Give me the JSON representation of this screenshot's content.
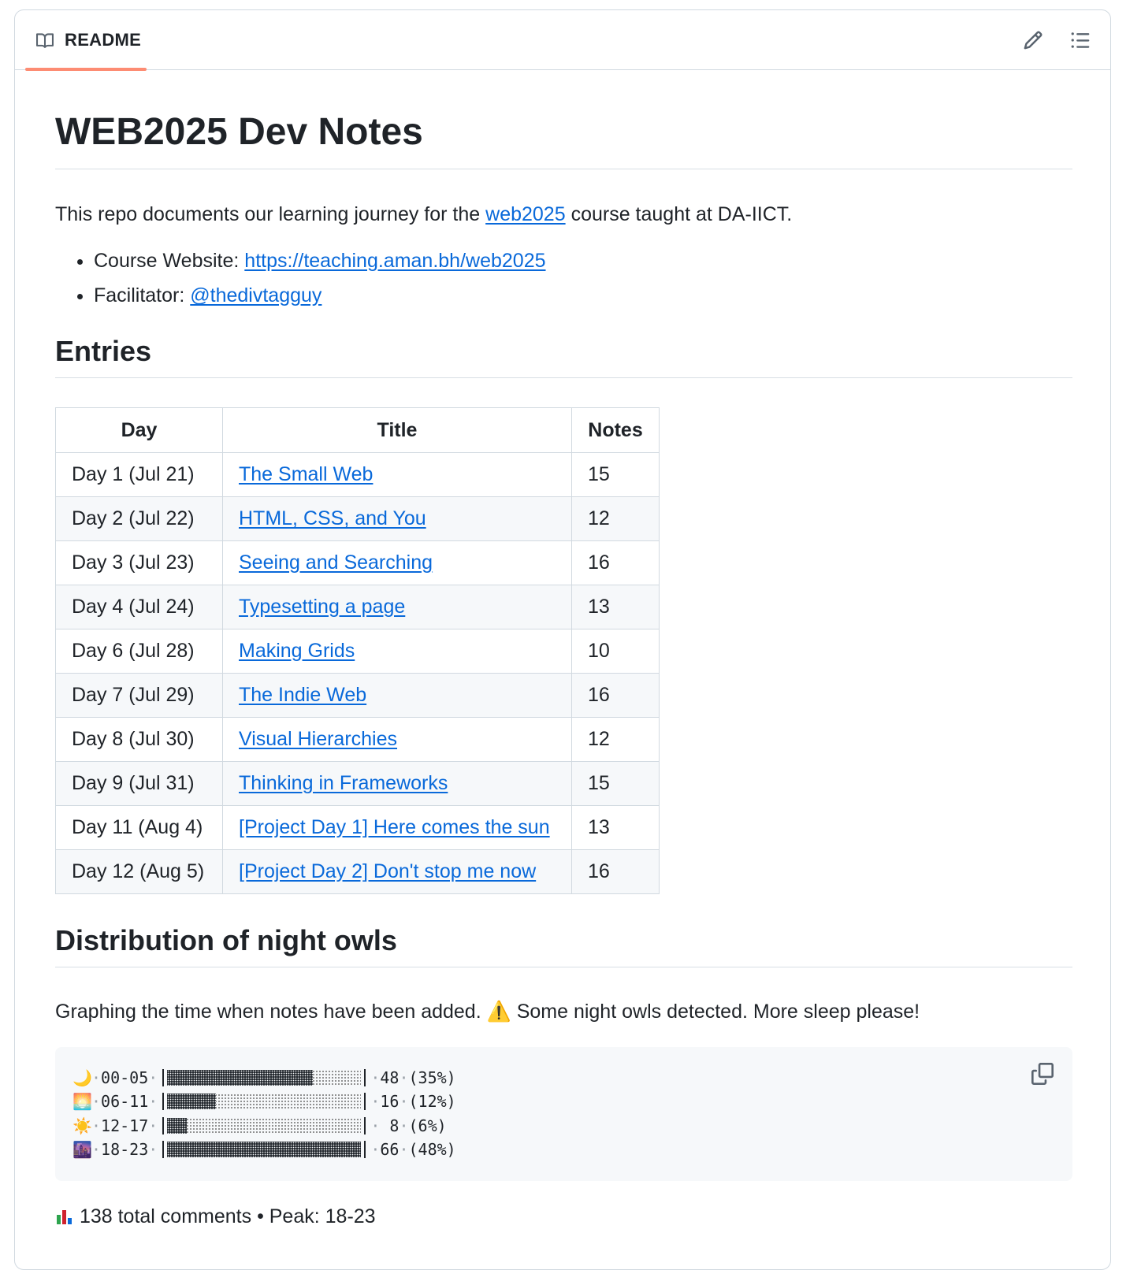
{
  "header": {
    "tab_label": "README",
    "icons": [
      "book-icon",
      "pencil-icon",
      "list-icon"
    ]
  },
  "doc": {
    "title": "WEB2025 Dev Notes",
    "intro_before": "This repo documents our learning journey for the ",
    "intro_link": "web2025",
    "intro_after": " course taught at DA-IICT.",
    "website_label": "Course Website: ",
    "website_link": "https://teaching.aman.bh/web2025",
    "facilitator_label": "Facilitator: ",
    "facilitator_link": "@thedivtagguy"
  },
  "entries": {
    "heading": "Entries",
    "columns": [
      "Day",
      "Title",
      "Notes"
    ],
    "rows": [
      {
        "day": "Day 1 (Jul 21)",
        "title": "The Small Web",
        "notes": "15"
      },
      {
        "day": "Day 2 (Jul 22)",
        "title": "HTML, CSS, and You",
        "notes": "12"
      },
      {
        "day": "Day 3 (Jul 23)",
        "title": "Seeing and Searching",
        "notes": "16"
      },
      {
        "day": "Day 4 (Jul 24)",
        "title": "Typesetting a page",
        "notes": "13"
      },
      {
        "day": "Day 6 (Jul 28)",
        "title": "Making Grids",
        "notes": "10"
      },
      {
        "day": "Day 7 (Jul 29)",
        "title": "The Indie Web",
        "notes": "16"
      },
      {
        "day": "Day 8 (Jul 30)",
        "title": "Visual Hierarchies",
        "notes": "12"
      },
      {
        "day": "Day 9 (Jul 31)",
        "title": "Thinking in Frameworks",
        "notes": "15"
      },
      {
        "day": "Day 11 (Aug 4)",
        "title": "[Project Day 1] Here comes the sun",
        "notes": "13"
      },
      {
        "day": "Day 12 (Aug 5)",
        "title": "[Project Day 2] Don't stop me now",
        "notes": "16"
      }
    ]
  },
  "owls": {
    "heading": "Distribution of night owls",
    "description_before": "Graphing the time when notes have been added. ",
    "warning_emoji": "⚠️",
    "description_after": " Some night owls detected. More sleep please!",
    "rows": [
      {
        "emoji": "🌙",
        "range": "00-05",
        "count": "48",
        "pct": "(35%)",
        "fraction": 0.75
      },
      {
        "emoji": "🌅",
        "range": "06-11",
        "count": "16",
        "pct": "(12%)",
        "fraction": 0.25
      },
      {
        "emoji": "☀️",
        "range": "12-17",
        "count": " 8",
        "pct": "(6%)",
        "fraction": 0.1
      },
      {
        "emoji": "🌆",
        "range": "18-23",
        "count": "66",
        "pct": "(48%)",
        "fraction": 1.0
      }
    ],
    "summary": "138 total comments • Peak: 18-23",
    "colors": {
      "fill": "#24292f",
      "code_bg": "#f6f8fa"
    }
  },
  "theme": {
    "link": "#0969da",
    "tab_underline": "#fd8c73",
    "border": "#d1d9e0"
  }
}
